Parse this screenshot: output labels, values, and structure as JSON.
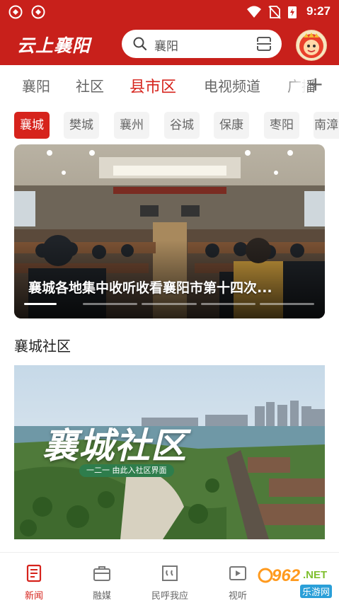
{
  "status": {
    "time": "9:27"
  },
  "header": {
    "logo": "云上襄阳",
    "search_query": "襄阳"
  },
  "tabs": [
    "襄阳",
    "社区",
    "县市区",
    "电视频道",
    "广播"
  ],
  "tabs_active": 2,
  "add_tab_label": "+",
  "chips": [
    "襄城",
    "樊城",
    "襄州",
    "谷城",
    "保康",
    "枣阳",
    "南漳"
  ],
  "chips_active": 0,
  "carousel": {
    "headline": "襄城各地集中收听收看襄阳市第十四次...",
    "slide_count": 5,
    "current_slide": 1
  },
  "section": {
    "title": "襄城社区"
  },
  "feature": {
    "big_text": "襄城社区",
    "sub_text": "一二一 由此入社区界面"
  },
  "bottom_nav": [
    {
      "label": "新闻",
      "icon": "news-icon",
      "active": true
    },
    {
      "label": "融媒",
      "icon": "briefcase-icon",
      "active": false
    },
    {
      "label": "民呼我应",
      "icon": "quote-icon",
      "active": false
    },
    {
      "label": "视听",
      "icon": "video-icon",
      "active": false
    }
  ],
  "watermark": {
    "num": "962",
    "net": ".NET",
    "sub": "乐游网"
  },
  "colors": {
    "brand_red": "#c8201b",
    "active_red": "#d6231c"
  }
}
